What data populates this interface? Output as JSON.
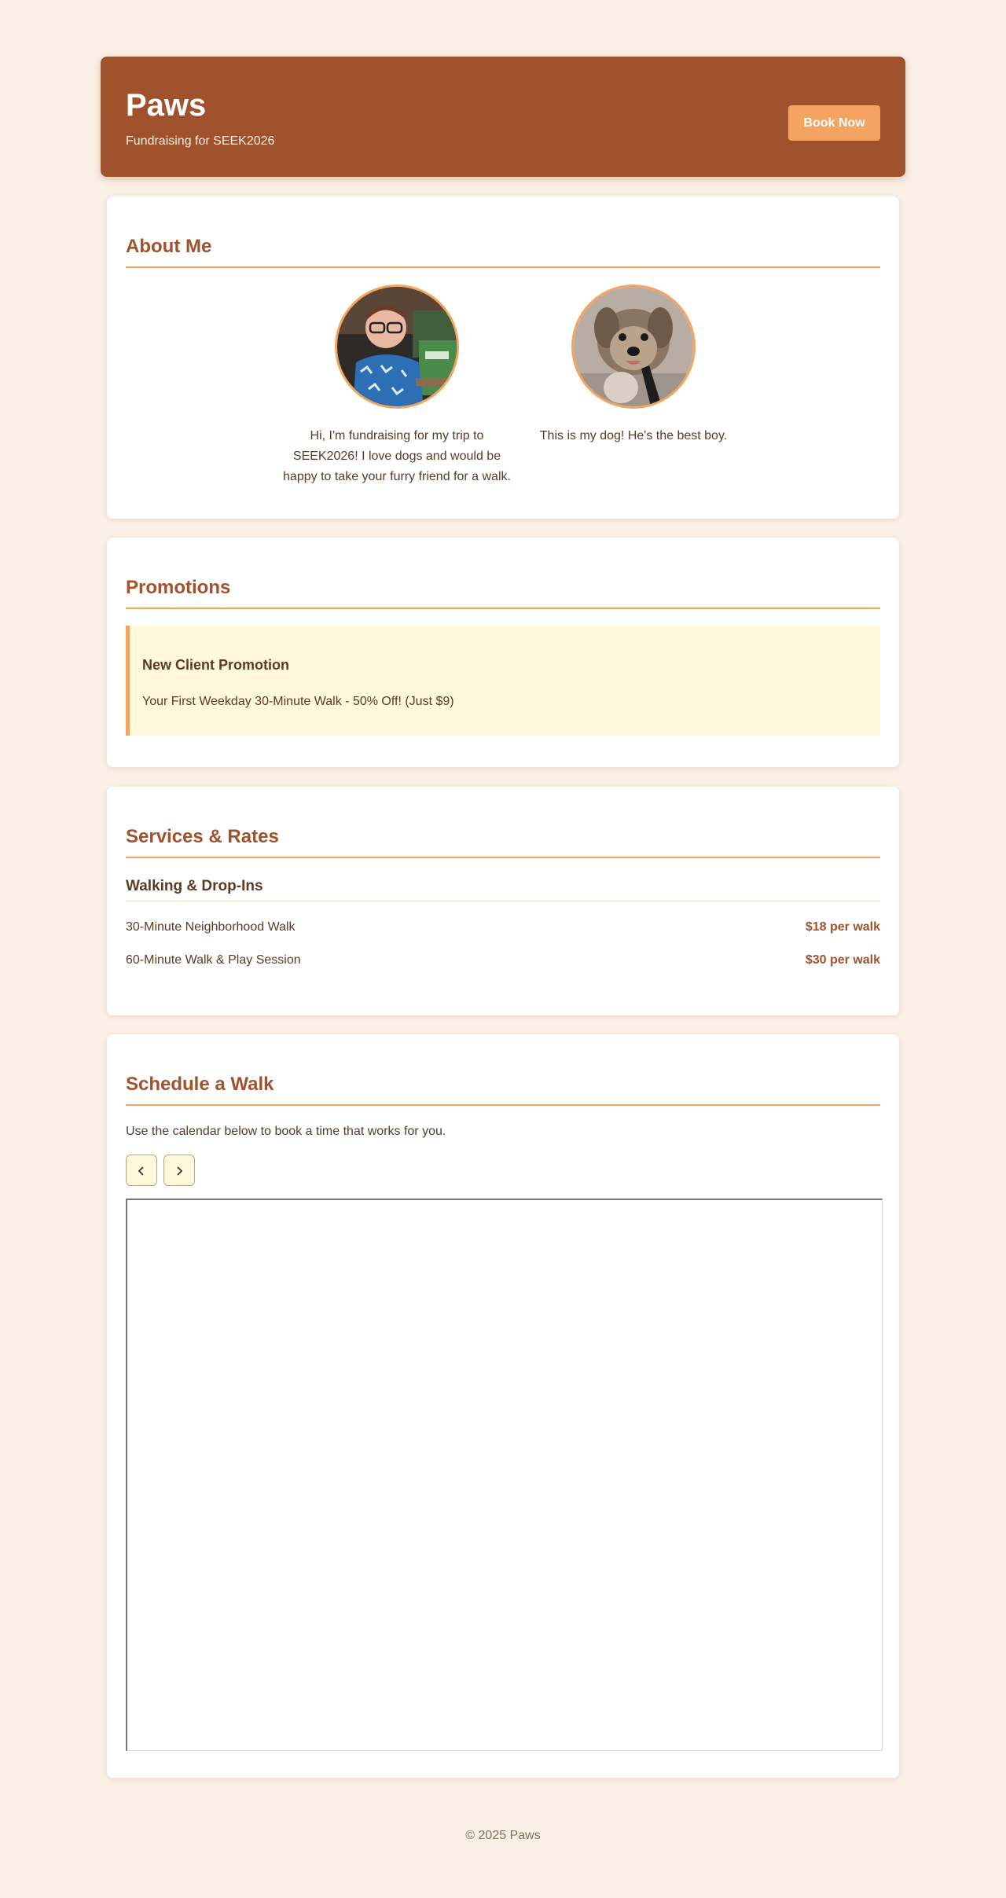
{
  "header": {
    "title": "Paws",
    "subtitle": "Fundraising for SEEK2026",
    "book_label": "Book Now"
  },
  "about": {
    "heading": "About Me",
    "people": [
      {
        "caption": "Hi, I'm fundraising for my trip to SEEK2026! I love dogs and would be happy to take your furry friend for a walk."
      },
      {
        "caption": "This is my dog! He's the best boy."
      }
    ]
  },
  "promotions": {
    "heading": "Promotions",
    "items": [
      {
        "title": "New Client Promotion",
        "text": "Your First Weekday 30-Minute Walk - 50% Off! (Just $9)"
      }
    ]
  },
  "services": {
    "heading": "Services & Rates",
    "subheading": "Walking & Drop-Ins",
    "rows": [
      {
        "name": "30-Minute Neighborhood Walk",
        "price": "$18 per walk"
      },
      {
        "name": "60-Minute Walk & Play Session",
        "price": "$30 per walk"
      }
    ]
  },
  "schedule": {
    "heading": "Schedule a Walk",
    "intro": "Use the calendar below to book a time that works for you.",
    "prev_icon": "chevron-left-icon",
    "next_icon": "chevron-right-icon"
  },
  "footer": {
    "text": "© 2025 Paws"
  },
  "colors": {
    "brand": "#a0522d",
    "accent": "#f4a460",
    "background": "#faf0e6",
    "promo_bg": "#fff8dc"
  }
}
